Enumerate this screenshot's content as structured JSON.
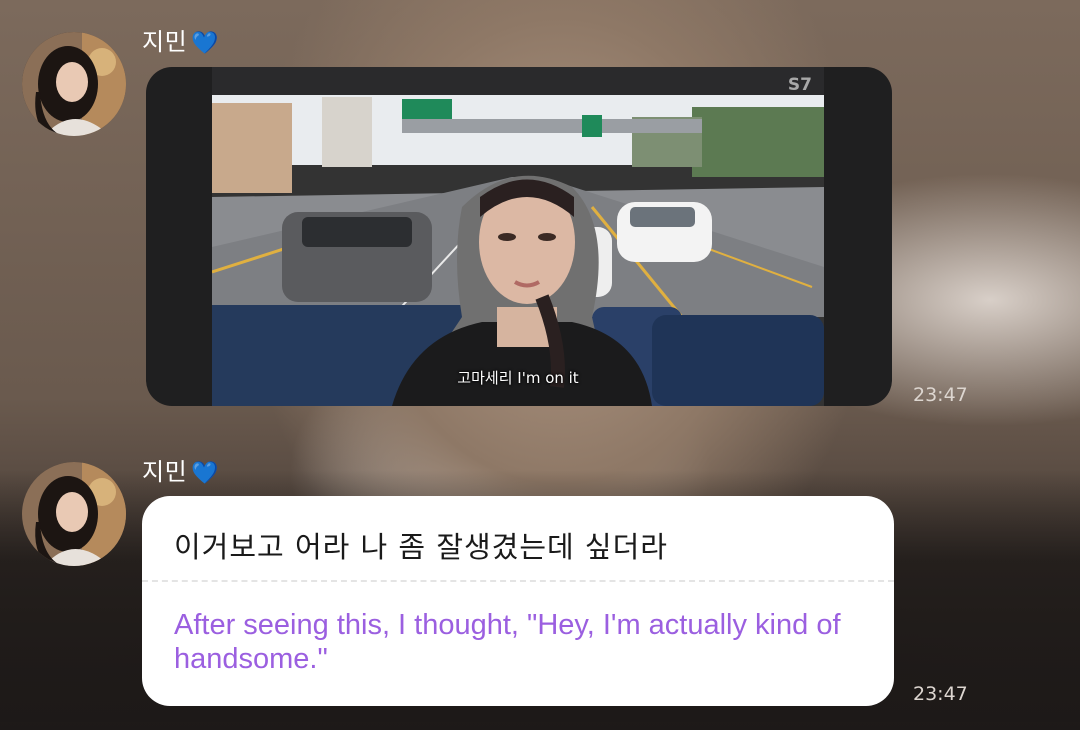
{
  "messages": [
    {
      "sender": "지민",
      "heart": "💙",
      "avatar": "profile-photo",
      "type": "video",
      "video": {
        "caption": "고마세리 I'm on it",
        "watermark": "S7"
      },
      "time": "23:47"
    },
    {
      "sender": "지민",
      "heart": "💙",
      "avatar": "profile-photo",
      "type": "text",
      "original": "이거보고 어라 나 좀 잘생겼는데 싶더라",
      "translation": "After seeing this, I thought, \"Hey, I'm actually kind of handsome.\"",
      "time": "23:47"
    }
  ],
  "colors": {
    "bubble_bg": "#ffffff",
    "translation_text": "#9b5fe0",
    "heart": "#63c8ee",
    "video_card_bg": "#1f1f20"
  }
}
